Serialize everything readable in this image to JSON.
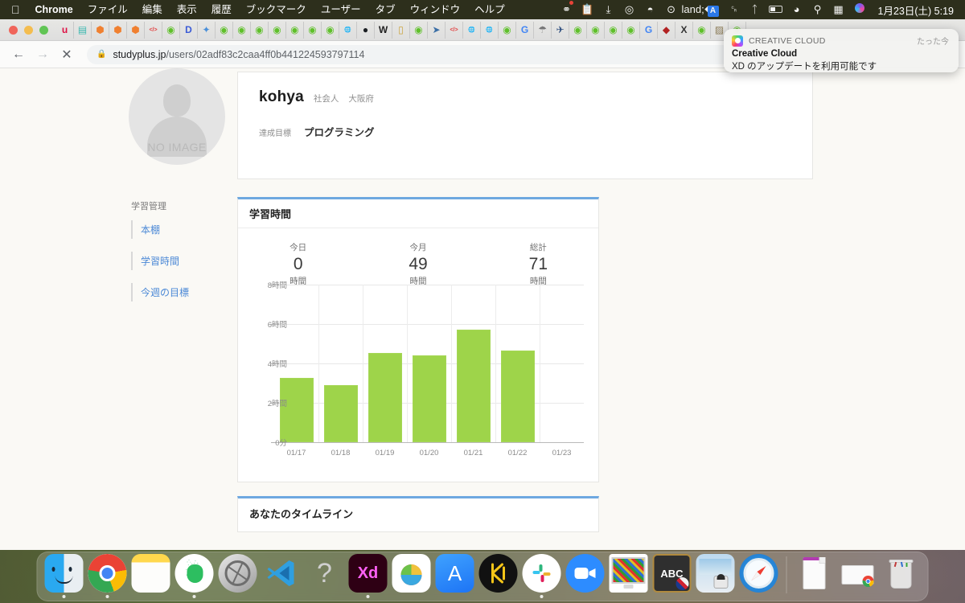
{
  "menubar": {
    "apple_icon": "apple-logo-icon",
    "items": [
      {
        "label": "Chrome",
        "bold": true
      },
      {
        "label": "ファイル",
        "bold": false
      },
      {
        "label": "編集",
        "bold": false
      },
      {
        "label": "表示",
        "bold": false
      },
      {
        "label": "履歴",
        "bold": false
      },
      {
        "label": "ブックマーク",
        "bold": false
      },
      {
        "label": "ユーザー",
        "bold": false
      },
      {
        "label": "タブ",
        "bold": false
      },
      {
        "label": "ウィンドウ",
        "bold": false
      },
      {
        "label": "ヘルプ",
        "bold": false
      }
    ],
    "status_icons": [
      {
        "name": "screen-recording-icon",
        "glyph": "◉"
      },
      {
        "name": "clipboard-icon",
        "glyph": "▤"
      },
      {
        "name": "download-icon",
        "glyph": "⤓"
      },
      {
        "name": "magnifier-app-icon",
        "glyph": "◎"
      },
      {
        "name": "evernote-icon",
        "glyph": "◓"
      },
      {
        "name": "play-circle-icon",
        "glyph": "⊙"
      },
      {
        "name": "time-machine-icon",
        "glyph": "◴"
      },
      {
        "name": "alfred-a-icon",
        "glyph": "A"
      },
      {
        "name": "headphones-icon",
        "glyph": "⌒"
      },
      {
        "name": "bluetooth-icon",
        "glyph": "⌁"
      },
      {
        "name": "battery-icon",
        "glyph": "▮"
      },
      {
        "name": "wifi-icon",
        "glyph": "◗"
      },
      {
        "name": "spotlight-search-icon",
        "glyph": "⌕"
      },
      {
        "name": "display-icon",
        "glyph": "▤"
      },
      {
        "name": "siri-icon",
        "glyph": "◉"
      }
    ],
    "clock": "1月23日(土)  5:19"
  },
  "browser": {
    "traffic_lights": [
      "close",
      "minimize",
      "zoom"
    ],
    "bookmarks": [
      {
        "name": "bookmark-u",
        "glyph": "u",
        "color": "#d14"
      },
      {
        "name": "bookmark-note",
        "glyph": "▤",
        "color": "#3cb8b0"
      },
      {
        "name": "bookmark-orange-1",
        "glyph": "⬢",
        "color": "#f08030"
      },
      {
        "name": "bookmark-orange-2",
        "glyph": "⬢",
        "color": "#f08030"
      },
      {
        "name": "bookmark-orange-3",
        "glyph": "⬢",
        "color": "#f08030"
      },
      {
        "name": "bookmark-red-code",
        "glyph": "</>",
        "color": "#e23b3b"
      },
      {
        "name": "bookmark-green-1",
        "glyph": "◉",
        "color": "#5fc02a"
      },
      {
        "name": "bookmark-d",
        "glyph": "D",
        "color": "#3b5bd6"
      },
      {
        "name": "bookmark-colorful",
        "glyph": "✦",
        "color": "#4a90d9"
      },
      {
        "name": "bookmark-green-2",
        "glyph": "◉",
        "color": "#5fc02a"
      },
      {
        "name": "bookmark-green-3",
        "glyph": "◉",
        "color": "#5fc02a"
      },
      {
        "name": "bookmark-green-4",
        "glyph": "◉",
        "color": "#5fc02a"
      },
      {
        "name": "bookmark-green-5",
        "glyph": "◉",
        "color": "#5fc02a"
      },
      {
        "name": "bookmark-green-6",
        "glyph": "◉",
        "color": "#5fc02a"
      },
      {
        "name": "bookmark-green-7",
        "glyph": "◉",
        "color": "#5fc02a"
      },
      {
        "name": "bookmark-green-8",
        "glyph": "◉",
        "color": "#5fc02a"
      },
      {
        "name": "bookmark-globe-1",
        "glyph": "🌐",
        "color": "#555"
      },
      {
        "name": "bookmark-github",
        "glyph": "●",
        "color": "#1b1f23"
      },
      {
        "name": "bookmark-wikipedia",
        "glyph": "W",
        "color": "#222"
      },
      {
        "name": "bookmark-bottle",
        "glyph": "▯",
        "color": "#caa33c"
      },
      {
        "name": "bookmark-green-9",
        "glyph": "◉",
        "color": "#5fc02a"
      },
      {
        "name": "bookmark-rocket",
        "glyph": "➤",
        "color": "#3a6ea5"
      },
      {
        "name": "bookmark-red-code-2",
        "glyph": "</>",
        "color": "#e23b3b"
      },
      {
        "name": "bookmark-globe-2",
        "glyph": "🌐",
        "color": "#555"
      },
      {
        "name": "bookmark-globe-3",
        "glyph": "🌐",
        "color": "#555"
      },
      {
        "name": "bookmark-green-10",
        "glyph": "◉",
        "color": "#5fc02a"
      },
      {
        "name": "bookmark-google-1",
        "glyph": "G",
        "color": "#4285f4"
      },
      {
        "name": "bookmark-umbrella",
        "glyph": "☂",
        "color": "#777"
      },
      {
        "name": "bookmark-plane",
        "glyph": "✈",
        "color": "#2f4f7f"
      },
      {
        "name": "bookmark-green-11",
        "glyph": "◉",
        "color": "#5fc02a"
      },
      {
        "name": "bookmark-green-12",
        "glyph": "◉",
        "color": "#5fc02a"
      },
      {
        "name": "bookmark-green-13",
        "glyph": "◉",
        "color": "#5fc02a"
      },
      {
        "name": "bookmark-green-14",
        "glyph": "◉",
        "color": "#5fc02a"
      },
      {
        "name": "bookmark-google-2",
        "glyph": "G",
        "color": "#4285f4"
      },
      {
        "name": "bookmark-meat",
        "glyph": "◆",
        "color": "#b22222"
      },
      {
        "name": "bookmark-latex",
        "glyph": "X",
        "color": "#333"
      },
      {
        "name": "bookmark-green-15",
        "glyph": "◉",
        "color": "#5fc02a"
      },
      {
        "name": "bookmark-image",
        "glyph": "▨",
        "color": "#8a7a55"
      },
      {
        "name": "bookmark-green-16",
        "glyph": "◉",
        "color": "#5fc02a"
      }
    ],
    "nav": {
      "back": "←",
      "forward": "→",
      "stop": "✕"
    },
    "address": {
      "lock_icon": "lock-icon",
      "host": "studyplus.jp",
      "path": "/users/02adf83c2caa4ff0b441224593797114",
      "full_url": "studyplus.jp/users/02adf83c2caa4ff0b441224593797114"
    }
  },
  "notification": {
    "app": "CREATIVE CLOUD",
    "time": "たった今",
    "title": "Creative Cloud",
    "body": "XD のアップデートを利用可能です"
  },
  "profile": {
    "avatar_placeholder": "NO IMAGE",
    "username": "kohya",
    "occupation": "社会人",
    "region": "大阪府",
    "goal_label": "達成目標",
    "goal_value": "プログラミング"
  },
  "sidebar": {
    "title": "学習管理",
    "items": [
      {
        "label": "本棚"
      },
      {
        "label": "学習時間"
      },
      {
        "label": "今週の目標"
      }
    ]
  },
  "study_card": {
    "title": "学習時間",
    "stats": [
      {
        "label": "今日",
        "value": "0",
        "unit": "時間"
      },
      {
        "label": "今月",
        "value": "49",
        "unit": "時間"
      },
      {
        "label": "総計",
        "value": "71",
        "unit": "時間"
      }
    ]
  },
  "timeline_card": {
    "title": "あなたのタイムライン"
  },
  "chart_data": {
    "type": "bar",
    "title": "学習時間",
    "xlabel": "",
    "ylabel": "",
    "categories": [
      "01/17",
      "01/18",
      "01/19",
      "01/20",
      "01/21",
      "01/22",
      "01/23"
    ],
    "values": [
      3.25,
      2.9,
      4.55,
      4.4,
      5.7,
      4.65,
      0
    ],
    "unit": "時間",
    "ylim": [
      0,
      8
    ],
    "ytick_values": [
      0,
      2,
      4,
      6,
      8
    ],
    "ytick_labels": [
      "0分",
      "2時間",
      "4時間",
      "6時間",
      "8時間"
    ],
    "grid": true,
    "legend": false,
    "bar_color": "#9ed44a"
  },
  "dock": {
    "items": [
      {
        "name": "finder-icon",
        "label": "Finder",
        "running": true
      },
      {
        "name": "chrome-icon",
        "label": "Google Chrome",
        "running": true
      },
      {
        "name": "notes-icon",
        "label": "Notes",
        "running": false
      },
      {
        "name": "evernote-icon",
        "label": "Evernote",
        "running": true
      },
      {
        "name": "preferences-icon",
        "label": "System Preferences",
        "running": false
      },
      {
        "name": "vscode-icon",
        "label": "Visual Studio Code",
        "running": false
      },
      {
        "name": "help-icon",
        "label": "Help",
        "running": false
      },
      {
        "name": "adobe-xd-icon",
        "label": "Adobe XD",
        "running": true
      },
      {
        "name": "paint-icon",
        "label": "Paint",
        "running": false
      },
      {
        "name": "app-store-icon",
        "label": "App Store",
        "running": false
      },
      {
        "name": "kibela-icon",
        "label": "Kibela",
        "running": false
      },
      {
        "name": "slack-icon",
        "label": "Slack",
        "running": true
      },
      {
        "name": "zoom-icon",
        "label": "Zoom",
        "running": false
      },
      {
        "name": "screensaver-icon",
        "label": "Screen Saver",
        "running": false
      },
      {
        "name": "dictionary-icon",
        "label": "Dictionary",
        "running": false
      },
      {
        "name": "image-capture-icon",
        "label": "Image Capture",
        "running": false
      },
      {
        "name": "safari-icon",
        "label": "Safari",
        "running": false
      },
      {
        "name": "document-icon",
        "label": "Document",
        "running": false
      },
      {
        "name": "downloads-stack-icon",
        "label": "Downloads",
        "running": false
      },
      {
        "name": "trash-icon",
        "label": "Trash",
        "running": false
      }
    ]
  }
}
